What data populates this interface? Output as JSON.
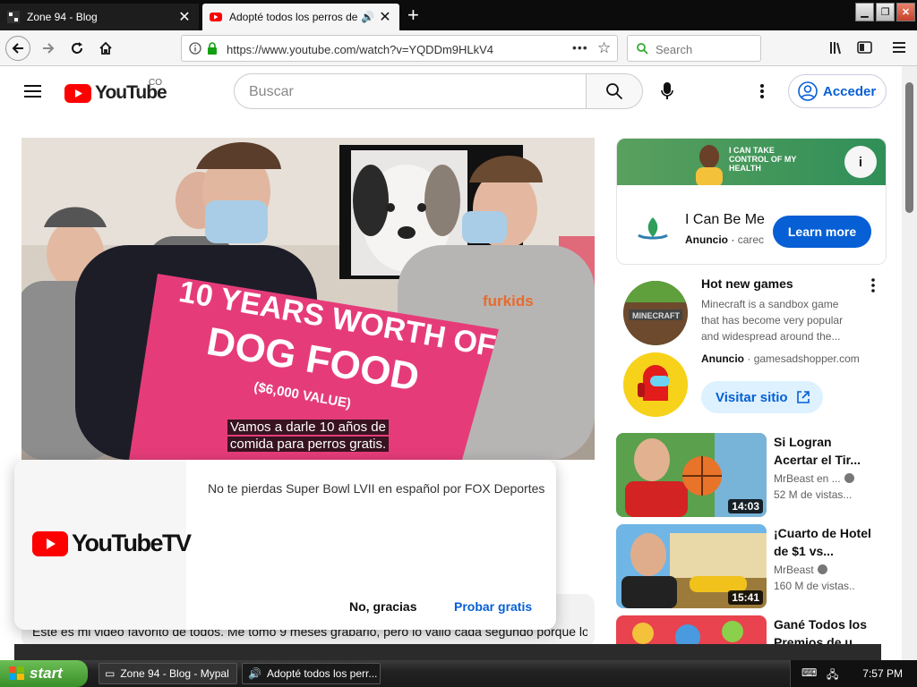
{
  "browser": {
    "tabs": [
      {
        "title": "Zone 94 - Blog",
        "active": false
      },
      {
        "title": "Adopté todos los perros de un",
        "active": true
      }
    ],
    "url": "https://www.youtube.com/watch?v=YQDDm9HLkV4",
    "search_placeholder": "Search",
    "icons": [
      "back-arrow-icon",
      "forward-arrow-icon",
      "reload-icon",
      "home-icon",
      "info-icon",
      "lock-icon",
      "page-actions-icon",
      "star-icon",
      "library-icon",
      "sidebar-icon",
      "hamburger-menu-icon"
    ]
  },
  "youtube": {
    "logo_text": "YouTube",
    "country_code": "CO",
    "search_placeholder": "Buscar",
    "sign_in": "Acceder",
    "brand_red": "#ff0000",
    "link_blue": "#065fd4"
  },
  "video": {
    "caption_line1": "Vamos a darle 10 años de",
    "caption_line2": "comida para perros gratis.",
    "sign_line1": "10 YEARS WORTH OF",
    "sign_line2": "DOG FOOD",
    "sign_line3": "($6,000 VALUE)",
    "shirt_text": "furkids"
  },
  "description": {
    "text": "Este es mi video favorito de todos. Me tomó 9 meses grabarlo, pero lo valió cada segundo porque los"
  },
  "popup": {
    "logo_text": "YouTubeTV",
    "message": "No te pierdas Super Bowl LVII en español por FOX Deportes",
    "decline": "No, gracias",
    "accept": "Probar gratis"
  },
  "ad_card": {
    "banner_text": "I CAN TAKE CONTROL OF MY HEALTH",
    "title": "I Can Be Me",
    "sponsor_label": "Anuncio",
    "sponsor": "carec",
    "cta": "Learn more"
  },
  "games_ad": {
    "title": "Hot new games",
    "description": "Minecraft is a sandbox game that has become very popular and widespread around the...",
    "sponsor_label": "Anuncio",
    "sponsor": "gamesadshopper.com",
    "cta": "Visitar sitio",
    "thumb_text": "MINECRAFT"
  },
  "recommendations": [
    {
      "title": "Si Logran Acertar el Tir...",
      "channel": "MrBeast en ...",
      "views": "52 M de vistas...",
      "duration": "14:03"
    },
    {
      "title": "¡Cuarto de Hotel de $1 vs...",
      "channel": "MrBeast",
      "views": "160 M de vistas...",
      "duration": "15:41"
    },
    {
      "title": "Gané Todos los Premios de u...",
      "channel": "",
      "views": "",
      "duration": ""
    }
  ],
  "taskbar": {
    "start": "start",
    "items": [
      "Zone 94 - Blog - Mypal",
      "Adopté todos los perr..."
    ],
    "clock": "7:57 PM"
  }
}
